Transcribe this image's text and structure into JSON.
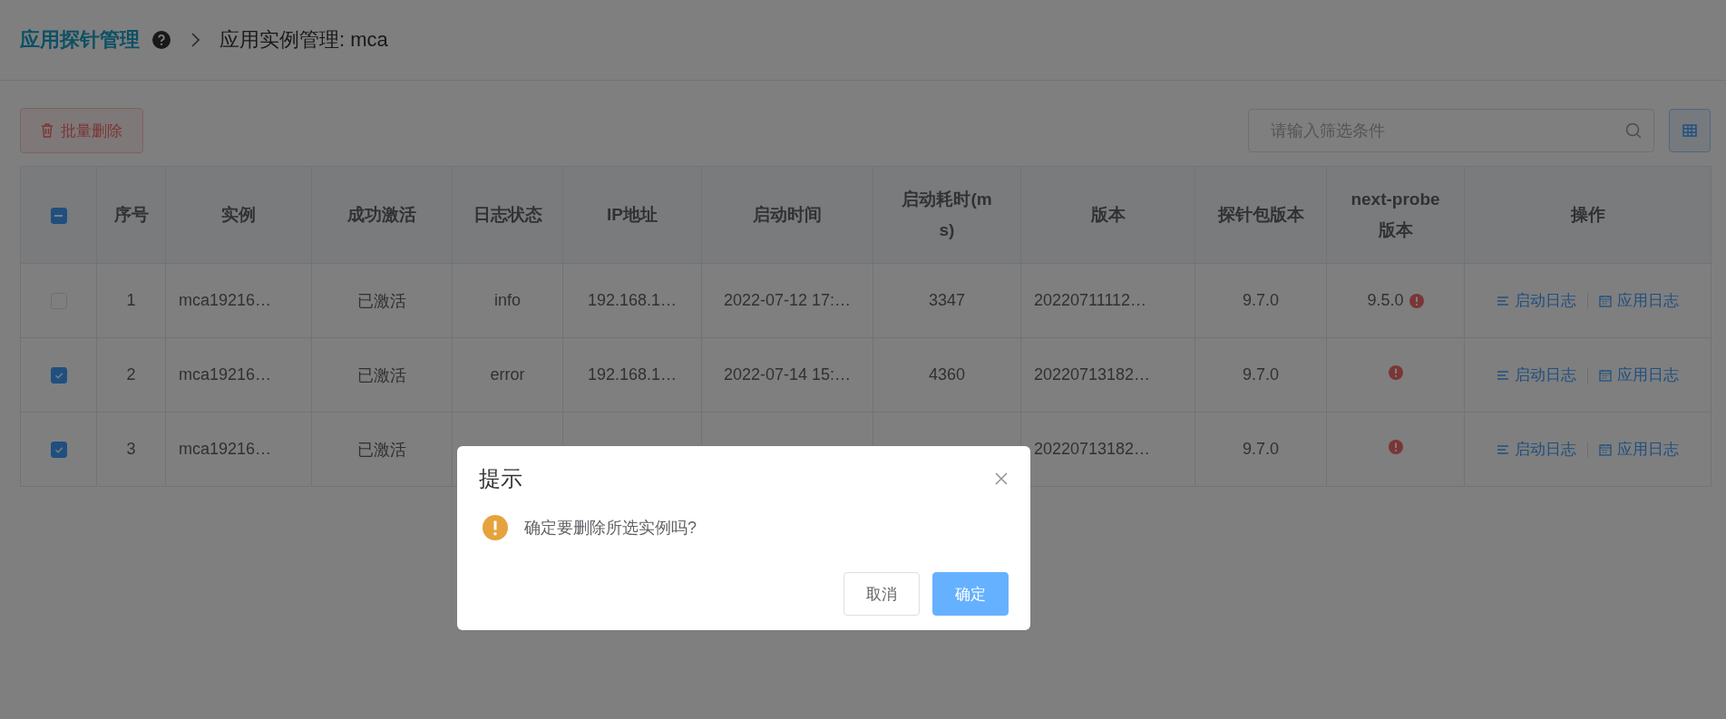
{
  "breadcrumb": {
    "title": "应用探针管理",
    "current": "应用实例管理: mca"
  },
  "toolbar": {
    "delete_button": "批量删除",
    "search": {
      "placeholder": "请输入筛选条件"
    }
  },
  "table": {
    "select_all": {
      "indeterminate": true
    },
    "columns": [
      "序号",
      "实例",
      "成功激活",
      "日志状态",
      "IP地址",
      "启动时间",
      "启动耗时(ms)",
      "版本",
      "探针包版本",
      "next-probe版本",
      "操作"
    ],
    "rows": [
      {
        "selected": false,
        "index": "1",
        "instance": "mca19216…",
        "activated": "已激活",
        "log_status": "info",
        "ip": "192.168.1…",
        "start_time": "2022-07-12 17:…",
        "duration": "3347",
        "version": "20220711112…",
        "probe_version": "9.7.0",
        "next_probe": {
          "text": "9.5.0",
          "warning": true
        },
        "actions": [
          {
            "kind": "startup-log",
            "label": "启动日志"
          },
          {
            "kind": "app-log",
            "label": "应用日志"
          }
        ]
      },
      {
        "selected": true,
        "index": "2",
        "instance": "mca19216…",
        "activated": "已激活",
        "log_status": "error",
        "ip": "192.168.1…",
        "start_time": "2022-07-14 15:…",
        "duration": "4360",
        "version": "20220713182…",
        "probe_version": "9.7.0",
        "next_probe": {
          "warning": true
        },
        "actions": [
          {
            "kind": "startup-log",
            "label": "启动日志"
          },
          {
            "kind": "app-log",
            "label": "应用日志"
          }
        ]
      },
      {
        "selected": true,
        "index": "3",
        "instance": "mca19216…",
        "activated": "已激活",
        "version": "20220713182…",
        "probe_version": "9.7.0",
        "next_probe": {
          "warning": true
        },
        "actions": [
          {
            "kind": "startup-log",
            "label": "启动日志"
          },
          {
            "kind": "app-log",
            "label": "应用日志"
          }
        ]
      }
    ]
  },
  "dialog": {
    "title": "提示",
    "message": "确定要删除所选实例吗?",
    "buttons": [
      {
        "kind": "cancel",
        "label": "取消"
      },
      {
        "kind": "primary",
        "label": "确定"
      }
    ]
  }
}
